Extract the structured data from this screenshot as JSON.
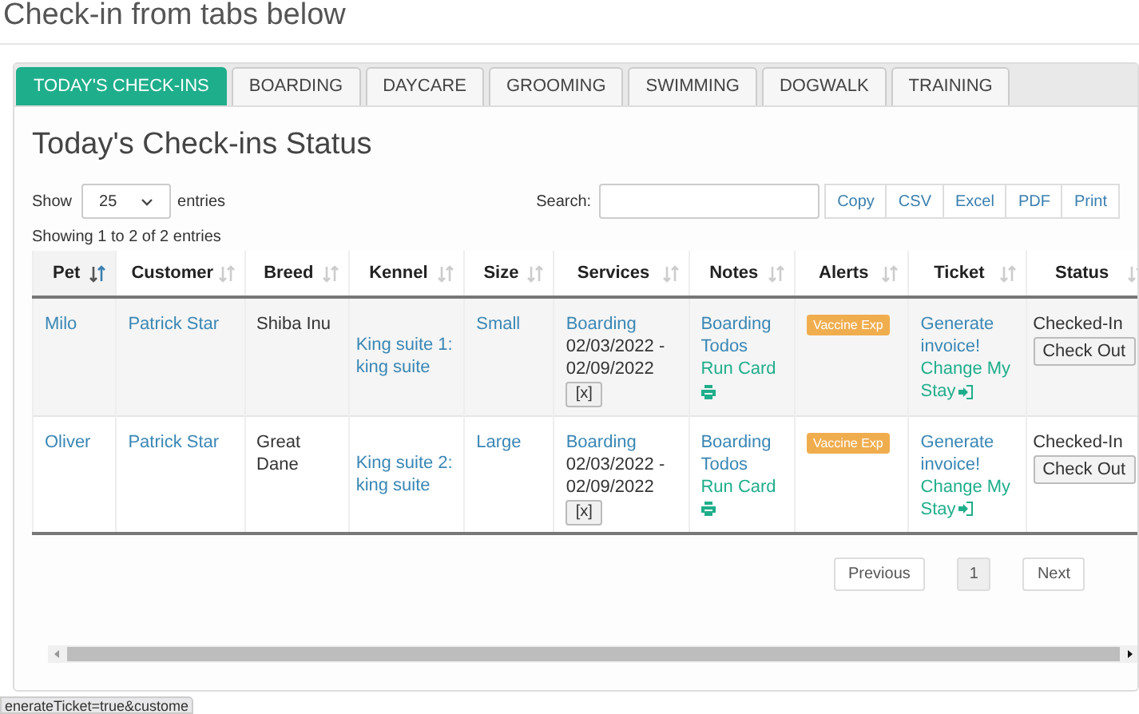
{
  "page_heading": "Check-in from tabs below",
  "tabs": [
    {
      "label": "TODAY'S CHECK-INS",
      "selected": true
    },
    {
      "label": "BOARDING",
      "selected": false
    },
    {
      "label": "DAYCARE",
      "selected": false
    },
    {
      "label": "GROOMING",
      "selected": false
    },
    {
      "label": "SWIMMING",
      "selected": false
    },
    {
      "label": "DOGWALK",
      "selected": false
    },
    {
      "label": "TRAINING",
      "selected": false
    }
  ],
  "panel_title": "Today's Check-ins Status",
  "length_menu": {
    "before": "Show",
    "value": "25",
    "after": "entries"
  },
  "search": {
    "label": "Search:"
  },
  "export_buttons": [
    "Copy",
    "CSV",
    "Excel",
    "PDF",
    "Print"
  ],
  "info": "Showing 1 to 2 of 2 entries",
  "table": {
    "columns": [
      {
        "label": "Pet",
        "sorted": true
      },
      {
        "label": "Customer",
        "sorted": false
      },
      {
        "label": "Breed",
        "sorted": false
      },
      {
        "label": "Kennel",
        "sorted": false
      },
      {
        "label": "Size",
        "sorted": false
      },
      {
        "label": "Services",
        "sorted": false
      },
      {
        "label": "Notes",
        "sorted": false
      },
      {
        "label": "Alerts",
        "sorted": false
      },
      {
        "label": "Ticket",
        "sorted": false
      },
      {
        "label": "Status",
        "sorted": false
      }
    ],
    "rows": [
      {
        "pet": "Milo",
        "customer": "Patrick Star",
        "breed": "Shiba Inu",
        "kennel": "King suite 1: king suite",
        "size": "Small",
        "service": {
          "name": "Boarding",
          "start": "02/03/2022 -",
          "end": "02/09/2022",
          "remove": "[x]"
        },
        "notes": {
          "todos": "Boarding Todos",
          "run_card": "Run Card"
        },
        "alert": "Vaccine Exp",
        "ticket": {
          "invoice": "Generate invoice!",
          "change": "Change My Stay"
        },
        "status": {
          "label": "Checked-In",
          "action": "Check Out"
        }
      },
      {
        "pet": "Oliver",
        "customer": "Patrick Star",
        "breed": "Great Dane",
        "kennel": "King suite 2: king suite",
        "size": "Large",
        "service": {
          "name": "Boarding",
          "start": "02/03/2022 -",
          "end": "02/09/2022",
          "remove": "[x]"
        },
        "notes": {
          "todos": "Boarding Todos",
          "run_card": "Run Card"
        },
        "alert": "Vaccine Exp",
        "ticket": {
          "invoice": "Generate invoice!",
          "change": "Change My Stay"
        },
        "status": {
          "label": "Checked-In",
          "action": "Check Out"
        }
      }
    ]
  },
  "pagination": {
    "previous": "Previous",
    "pages": [
      {
        "label": "1",
        "selected": true
      }
    ],
    "next": "Next"
  },
  "status_bar": "enerateTicket=true&custome"
}
